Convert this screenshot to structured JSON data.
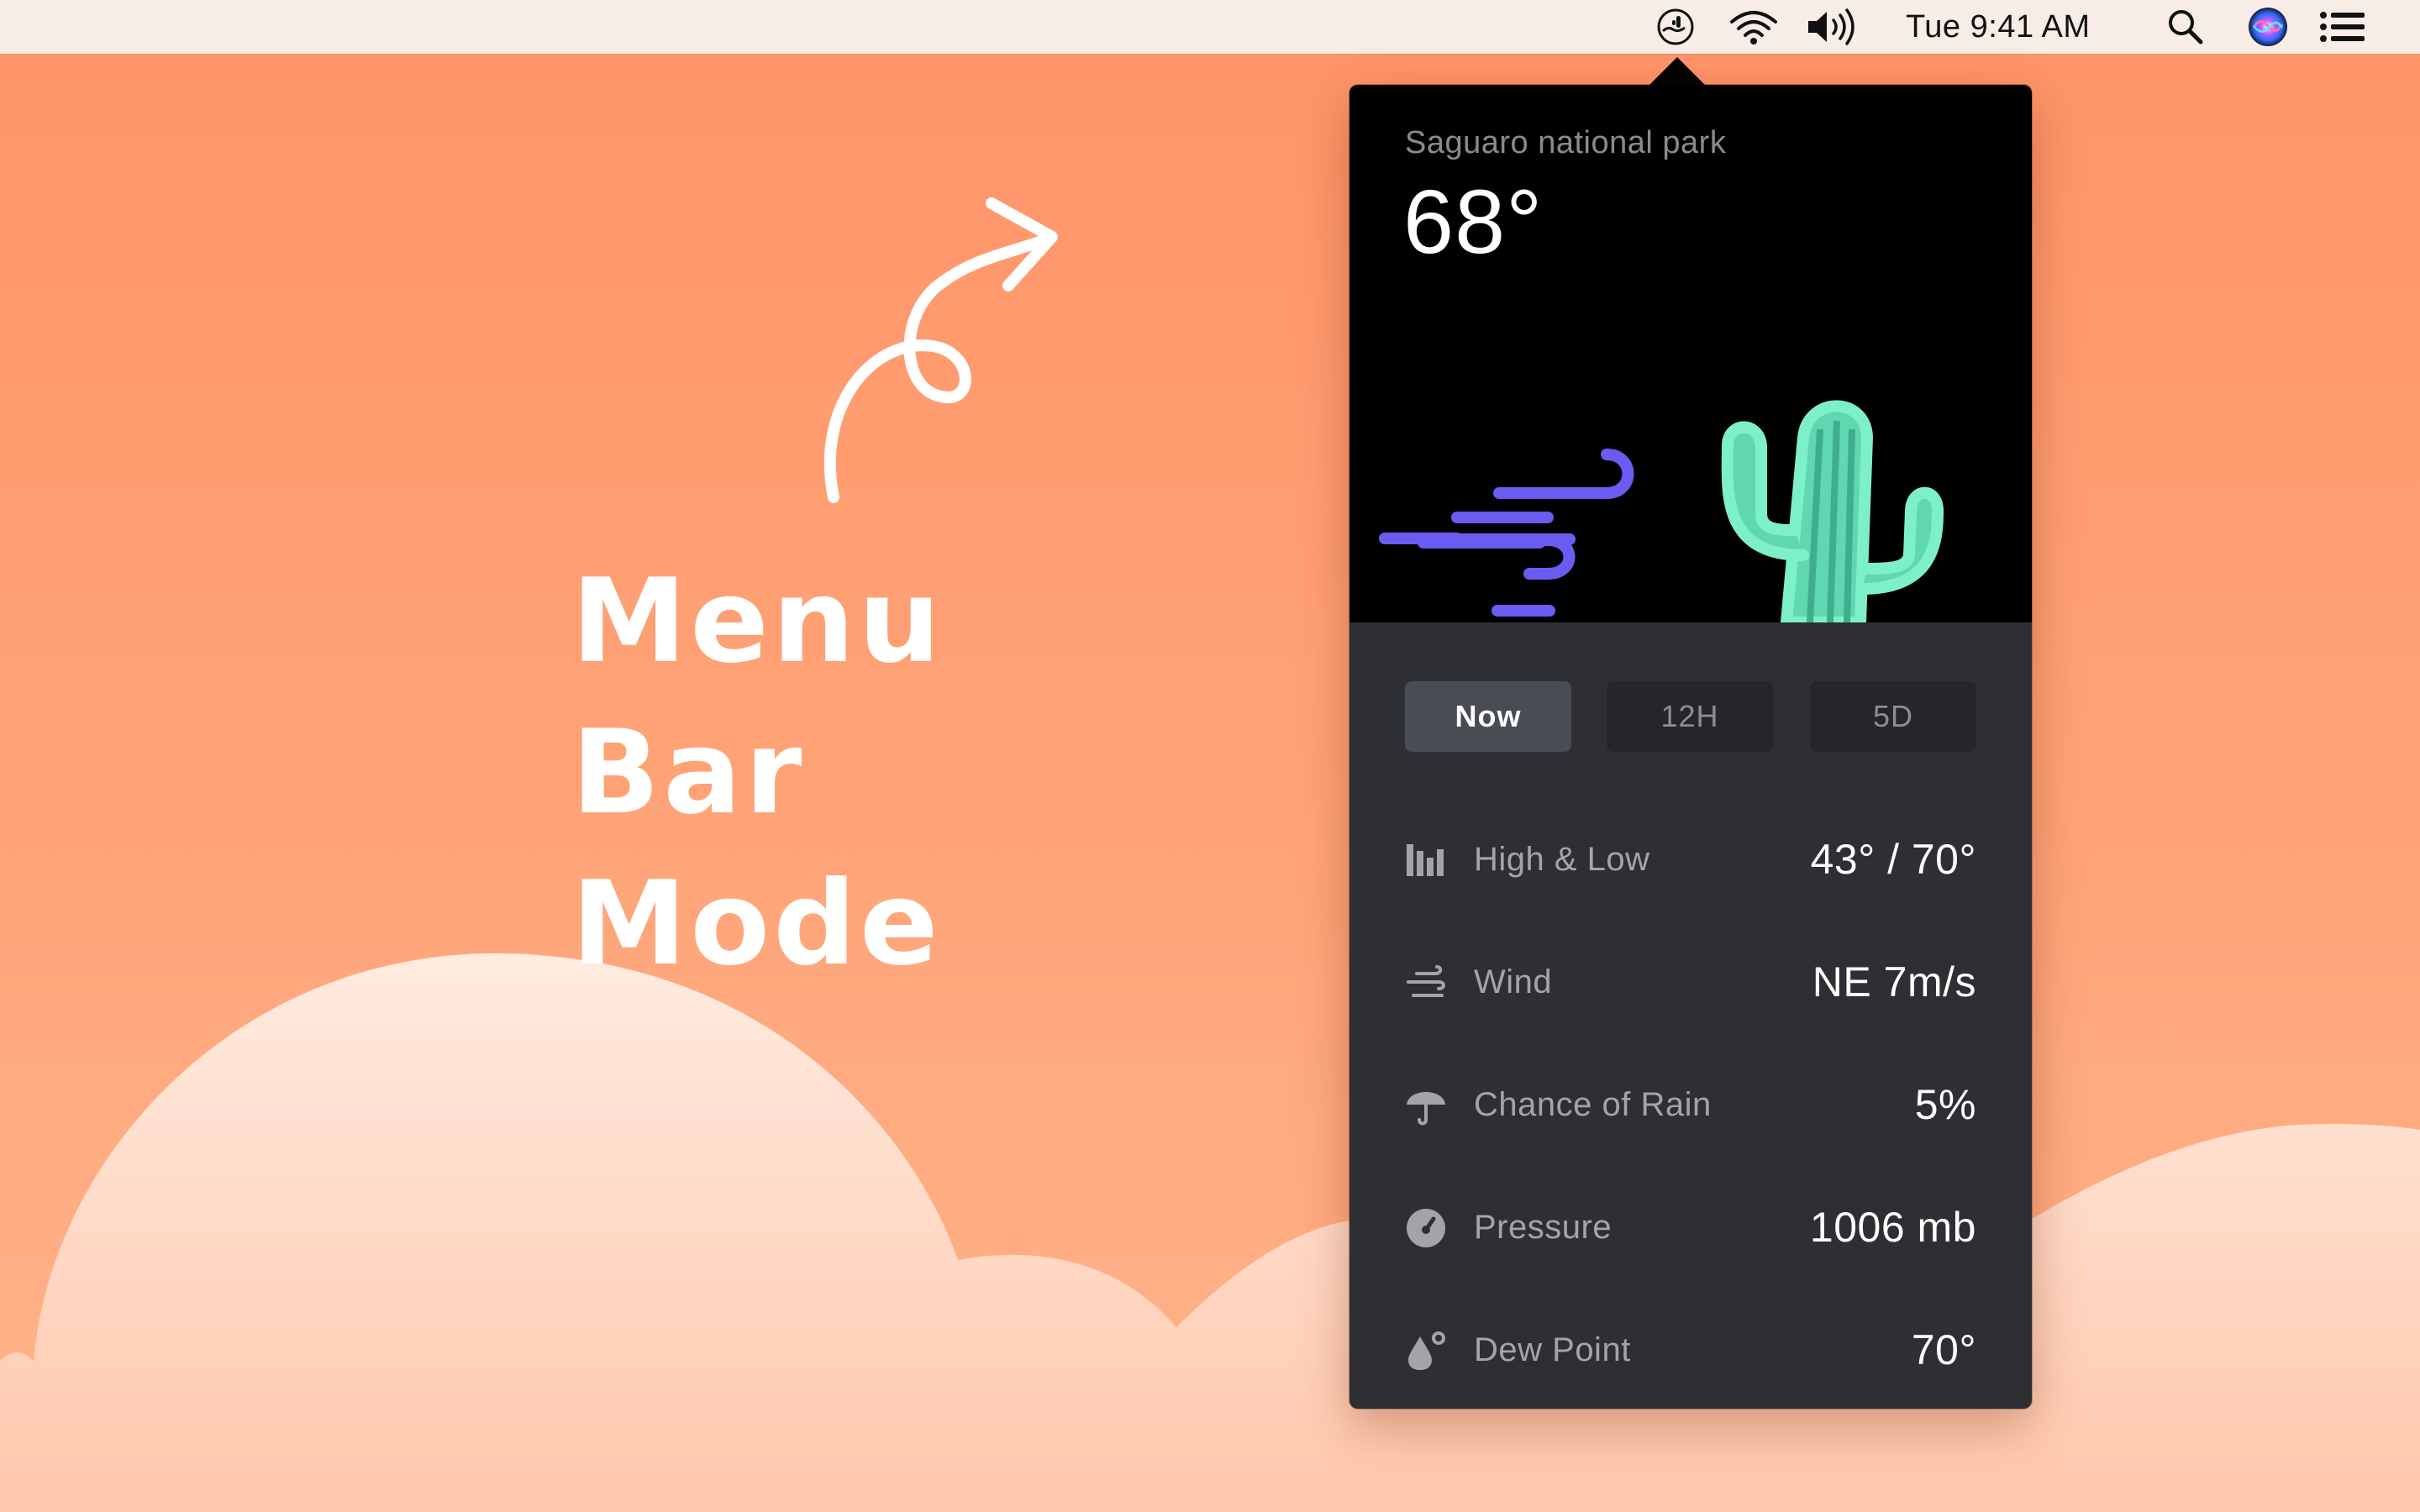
{
  "menubar": {
    "clock": "Tue 9:41 AM",
    "icons": [
      "weather-app-icon",
      "wifi-icon",
      "volume-icon",
      "search-icon",
      "siri-icon",
      "notification-center-icon"
    ]
  },
  "hero": {
    "title_line1": "Menu Bar",
    "title_line2": "Mode"
  },
  "popover": {
    "location": "Saguaro national park",
    "temperature": "68°",
    "tabs": [
      {
        "label": "Now",
        "active": true
      },
      {
        "label": "12H",
        "active": false
      },
      {
        "label": "5D",
        "active": false
      }
    ],
    "rows": [
      {
        "icon": "bar-chart-icon",
        "label": "High & Low",
        "value": "43° / 70°"
      },
      {
        "icon": "wind-icon",
        "label": "Wind",
        "value": "NE 7m/s"
      },
      {
        "icon": "umbrella-icon",
        "label": "Chance of Rain",
        "value": "5%"
      },
      {
        "icon": "gauge-icon",
        "label": "Pressure",
        "value": "1006 mb"
      },
      {
        "icon": "droplet-icon",
        "label": "Dew Point",
        "value": "70°"
      }
    ]
  },
  "colors": {
    "background": "#ff9f72",
    "cloud": "#ffe4d6",
    "popover_dark": "#2e2f33",
    "wind_purple": "#6a5cf0",
    "cactus_mint": "#7ef0c9"
  }
}
